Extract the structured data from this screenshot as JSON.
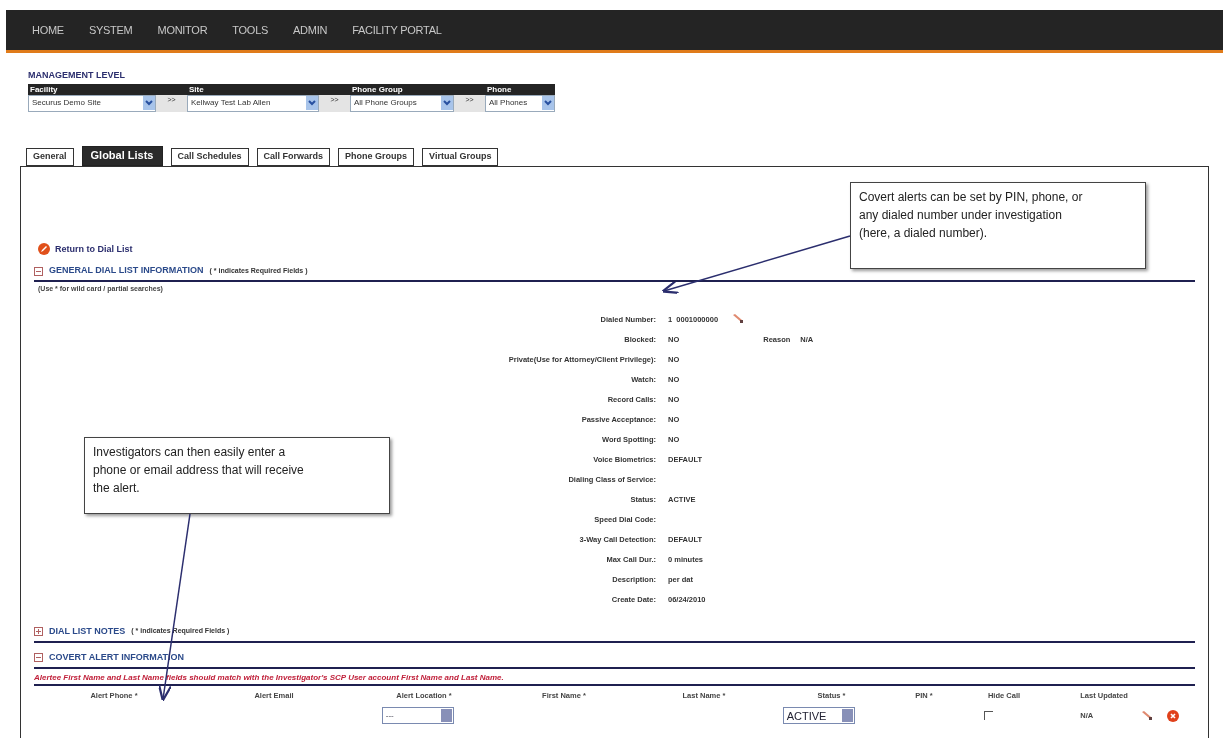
{
  "nav": [
    "HOME",
    "SYSTEM",
    "MONITOR",
    "TOOLS",
    "ADMIN",
    "FACILITY PORTAL"
  ],
  "management_level": {
    "title": "MANAGEMENT LEVEL",
    "selectors": [
      {
        "label": "Facility",
        "value": "Securus Demo Site"
      },
      {
        "label": "Site",
        "value": "Kellway Test Lab Allen"
      },
      {
        "label": "Phone Group",
        "value": "All Phone Groups"
      },
      {
        "label": "Phone",
        "value": "All Phones"
      }
    ],
    "separator": ">>"
  },
  "tabs": [
    {
      "label": "General",
      "selected": false
    },
    {
      "label": "Global Lists",
      "selected": true
    },
    {
      "label": "Call Schedules",
      "selected": false
    },
    {
      "label": "Call Forwards",
      "selected": false
    },
    {
      "label": "Phone Groups",
      "selected": false
    },
    {
      "label": "Virtual Groups",
      "selected": false
    }
  ],
  "return_link": "Return to Dial List",
  "general_section": {
    "title": "GENERAL DIAL LIST INFORMATION",
    "expanded": true,
    "note": "( * indicates Required Fields )",
    "hint": "(Use * for wild card / partial searches)",
    "rows": [
      {
        "kind": "editable",
        "label": "Dialed Number:",
        "value": "1  0001000000"
      },
      {
        "kind": "reason",
        "label": "Blocked:",
        "value": "NO",
        "extra_label": "Reason",
        "extra_value": "N/A"
      },
      {
        "kind": "plain",
        "label": "Private(Use for Attorney/Client Privilege):",
        "value": "NO"
      },
      {
        "kind": "plain",
        "label": "Watch:",
        "value": "NO"
      },
      {
        "kind": "plain",
        "label": "Record Calls:",
        "value": "NO"
      },
      {
        "kind": "plain",
        "label": "Passive Acceptance:",
        "value": "NO"
      },
      {
        "kind": "plain",
        "label": "Word Spotting:",
        "value": "NO"
      },
      {
        "kind": "plain",
        "label": "Voice Biometrics:",
        "value": "DEFAULT"
      },
      {
        "kind": "plain",
        "label": "Dialing Class of Service:"
      },
      {
        "kind": "plain",
        "label": "Status:",
        "value": "ACTIVE"
      },
      {
        "kind": "plain",
        "label": "Speed Dial Code:"
      },
      {
        "kind": "plain",
        "label": "3-Way Call Detection:",
        "value": "DEFAULT"
      },
      {
        "kind": "plain",
        "label": "Max Call Dur.:",
        "value": "0 minutes"
      },
      {
        "kind": "plain",
        "label": "Description:",
        "value": "per dat"
      },
      {
        "kind": "plain",
        "label": "Create Date:",
        "value": "06/24/2010"
      }
    ]
  },
  "notes_section": {
    "title": "DIAL LIST NOTES",
    "expanded": false,
    "note": "( * indicates Required Fields )"
  },
  "covert_section": {
    "title": "COVERT ALERT INFORMATION",
    "expanded": true,
    "warning": "Alertee First Name and Last Name fields should match with the Investigator's SCP User account First Name and Last Name.",
    "columns": [
      "Alert Phone *",
      "Alert Email",
      "Alert Location *",
      "First Name *",
      "Last Name *",
      "Status *",
      "PIN *",
      "Hide Call",
      "Last Updated"
    ],
    "row": [
      {
        "kind": "blank"
      },
      {
        "kind": "blank"
      },
      {
        "kind": "select",
        "value": "---"
      },
      {
        "kind": "blank"
      },
      {
        "kind": "blank"
      },
      {
        "kind": "select",
        "value": "ACTIVE"
      },
      {
        "kind": "blank"
      },
      {
        "kind": "checkbox",
        "checked": false
      },
      {
        "kind": "text",
        "value": "N/A"
      },
      {
        "kind": "actions"
      }
    ]
  },
  "callouts": [
    {
      "text": "Covert alerts can be set by PIN, phone, or any dialed number under investigation (here, a dialed number)."
    },
    {
      "text": "Investigators can then easily enter a phone or email address that will receive the alert."
    }
  ]
}
